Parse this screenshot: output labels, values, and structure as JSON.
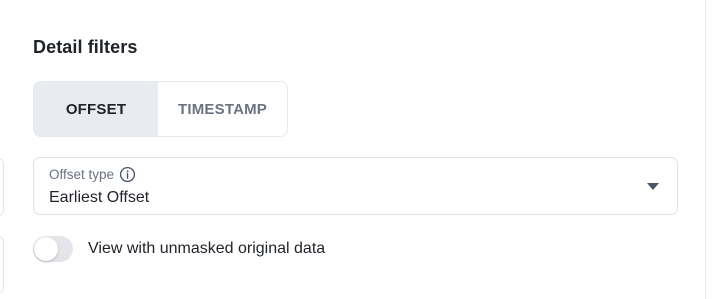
{
  "detail_filters": {
    "title": "Detail filters",
    "segments": [
      {
        "label": "OFFSET",
        "active": true
      },
      {
        "label": "TIMESTAMP",
        "active": false
      }
    ],
    "offset_type": {
      "label": "Offset type",
      "value": "Earliest Offset",
      "icon": "info-icon"
    },
    "unmasked_toggle": {
      "label": "View with unmasked original data",
      "checked": false
    }
  },
  "colors": {
    "active_segment_bg": "#e8ebef",
    "text_primary": "#1f2329",
    "text_muted": "#6b7280",
    "border": "#dfe2e6",
    "toggle_off": "#e3e5e8"
  }
}
